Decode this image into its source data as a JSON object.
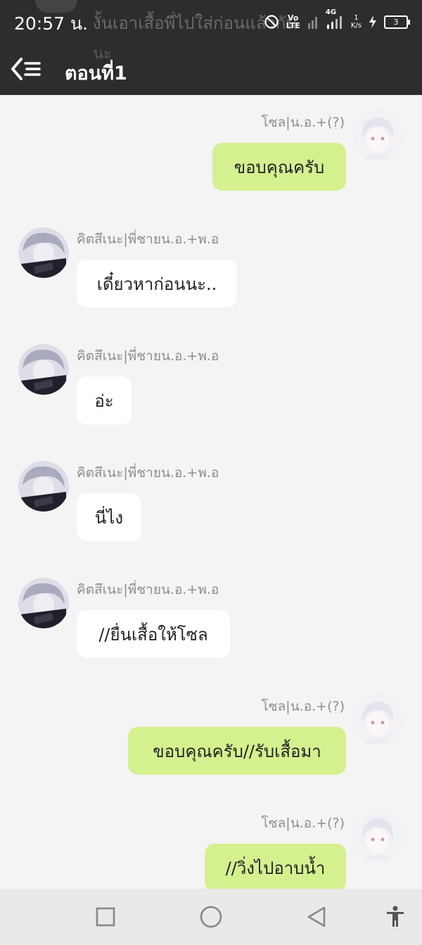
{
  "status_bar": {
    "time": "20:57 น.",
    "volte_top": "Vo",
    "volte_bottom": "LTE",
    "network_type": "4G",
    "speed_value": "1",
    "speed_unit": "K/s",
    "battery_level": "3"
  },
  "background_preview": {
    "line1": "งั้นเอาเสื้อพี่ไปใส่ก่อนแล้วกัน",
    "line2": "นะ"
  },
  "header": {
    "title": "ตอนที่1",
    "back_icon": "back-menu-icon"
  },
  "colors": {
    "header_bg": "#2d2d2d",
    "chat_bg": "#f4f4f4",
    "right_bubble": "#d5f08f",
    "left_bubble": "#ffffff",
    "name_text": "#8e8e8e"
  },
  "messages": [
    {
      "side": "right",
      "sender": "โซล|น.อ.+(?)",
      "text": "ขอบคุณครับ"
    },
    {
      "side": "left",
      "sender": "คิตสึเนะ|พี่ชายน.อ.+พ.อ",
      "text": "เดี๋ยวหาก่อนนะ.."
    },
    {
      "side": "left",
      "sender": "คิตสึเนะ|พี่ชายน.อ.+พ.อ",
      "text": "อ่ะ"
    },
    {
      "side": "left",
      "sender": "คิตสึเนะ|พี่ชายน.อ.+พ.อ",
      "text": "นี่ไง"
    },
    {
      "side": "left",
      "sender": "คิตสึเนะ|พี่ชายน.อ.+พ.อ",
      "text": "//ยื่นเสื้อให้โซล"
    },
    {
      "side": "right",
      "sender": "โซล|น.อ.+(?)",
      "text": "ขอบคุณครับ//รับเสื้อมา"
    },
    {
      "side": "right",
      "sender": "โซล|น.อ.+(?)",
      "text": "//วิ่งไปอาบน้ำ"
    }
  ],
  "nav_bar": {
    "recents_icon": "square-icon",
    "home_icon": "circle-icon",
    "back_icon": "triangle-back-icon",
    "accessibility_icon": "accessibility-icon"
  }
}
